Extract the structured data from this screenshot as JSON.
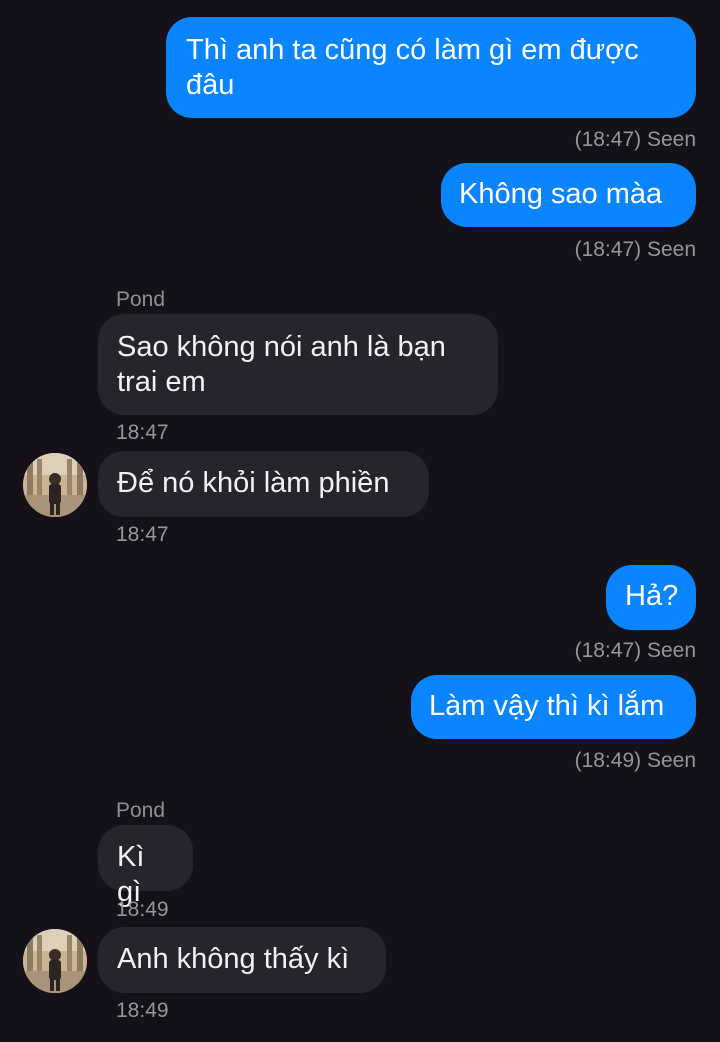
{
  "messages": [
    {
      "id": "m1",
      "direction": "outgoing",
      "text": "Thì anh ta cũng có làm gì em được đâu",
      "meta": "(18:47) Seen"
    },
    {
      "id": "m2",
      "direction": "outgoing",
      "text": "Không sao màa",
      "meta": "(18:47) Seen"
    },
    {
      "id": "m3",
      "direction": "incoming",
      "sender": "Pond",
      "text": "Sao không nói anh là bạn trai em",
      "time": "18:47"
    },
    {
      "id": "m4",
      "direction": "incoming",
      "text": "Để nó khỏi làm phiền",
      "time": "18:47",
      "avatar": "contact-avatar"
    },
    {
      "id": "m5",
      "direction": "outgoing",
      "text": "Hả?",
      "meta": "(18:47) Seen"
    },
    {
      "id": "m6",
      "direction": "outgoing",
      "text": "Làm vậy thì kì lắm",
      "meta": "(18:49) Seen"
    },
    {
      "id": "m7",
      "direction": "incoming",
      "sender": "Pond",
      "text": "Kì gì",
      "time": "18:49"
    },
    {
      "id": "m8",
      "direction": "incoming",
      "text": "Anh không thấy kì",
      "time": "18:49",
      "avatar": "contact-avatar"
    }
  ],
  "colors": {
    "background": "#141218",
    "outgoing_bubble": "#0a84ff",
    "incoming_bubble": "#262529",
    "meta_text": "#96959b"
  }
}
